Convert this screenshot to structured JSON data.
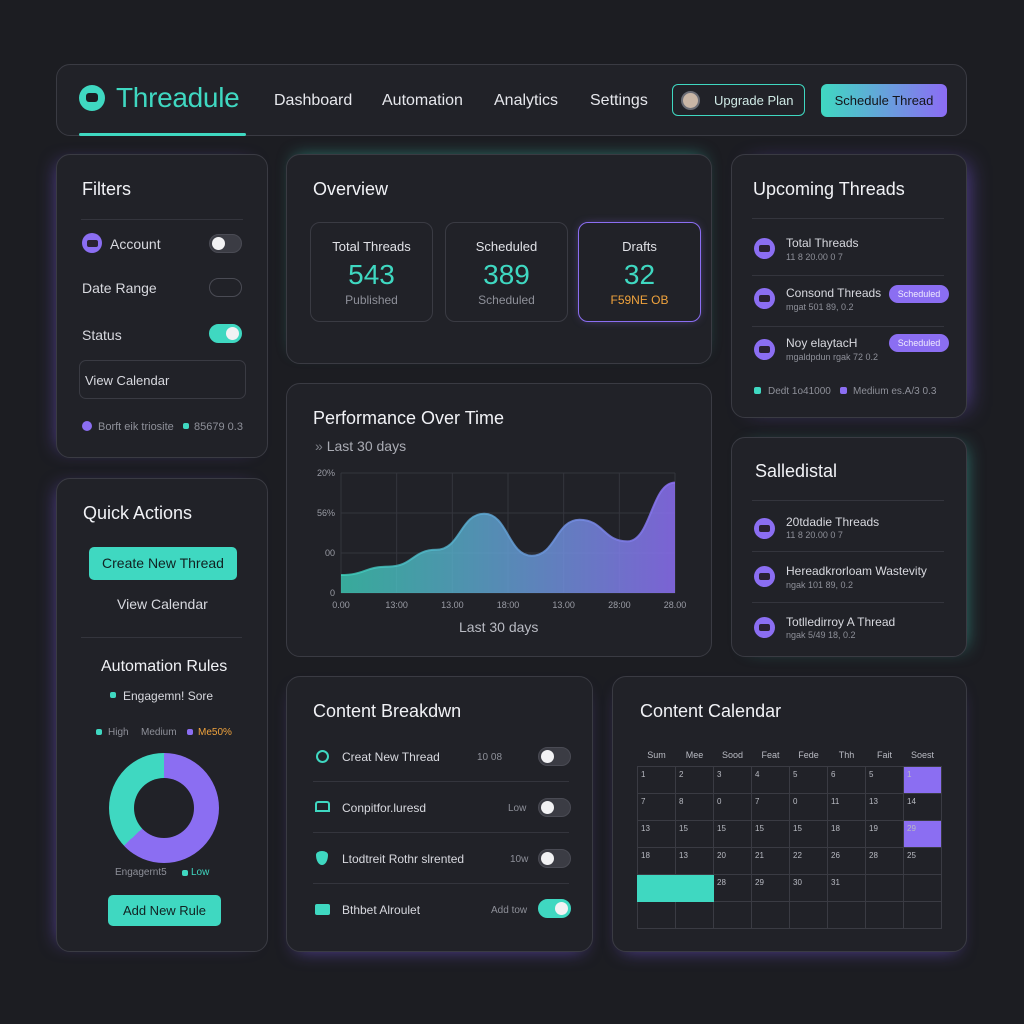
{
  "colors": {
    "accent": "#3fd8c1",
    "purple": "#8b6ef2",
    "background": "#1c1d22",
    "panel": "#212228"
  },
  "header": {
    "brand": "Threadule",
    "nav": [
      "Dashboard",
      "Automation",
      "Analytics",
      "Settings"
    ],
    "upgrade_label": "Upgrade Plan",
    "schedule_label": "Schedule Thread"
  },
  "filters": {
    "title": "Filters",
    "account": "Account",
    "date_range": "Date Range",
    "status": "Status",
    "view_calendar": "View Calendar",
    "footer_left": "Borft eik triosite",
    "footer_right": "85679 0.3",
    "toggles": {
      "account": false,
      "status": true
    }
  },
  "overview": {
    "title": "Overview",
    "stats": [
      {
        "label": "Total Threads",
        "value": "543",
        "sub": "Published"
      },
      {
        "label": "Scheduled",
        "value": "389",
        "sub": "Scheduled"
      },
      {
        "label": "Drafts",
        "value": "32",
        "sub": "F59NE OB"
      }
    ]
  },
  "upcoming": {
    "title": "Upcoming Threads",
    "items": [
      {
        "title": "Total Threads",
        "sub": "11 8 20.00 0 7",
        "badge": ""
      },
      {
        "title": "Consond Threads",
        "sub": "mgat 501 89, 0.2",
        "badge": "Scheduled"
      },
      {
        "title": "Noy elaytacH",
        "sub": "mgaldpdun rgak 72 0.2",
        "badge": "Scheduled"
      }
    ],
    "legend": [
      {
        "label": "Dedt 1o41000"
      },
      {
        "label": "Medium  es.A/3 0.3"
      }
    ]
  },
  "quick_actions": {
    "title": "Quick Actions",
    "create": "Create New Thread",
    "view_calendar": "View Calendar"
  },
  "automation": {
    "title": "Automation Rules",
    "legend_title": "Engagemn! Sore",
    "legend": [
      "High",
      "Medium",
      "Me50%"
    ],
    "footer_a": "Engagernt5",
    "footer_b": "Low",
    "add_rule": "Add New Rule"
  },
  "performance": {
    "title": "Performance Over Time",
    "subtitle": "Last 30 days",
    "x_caption": "Last 30 days"
  },
  "chart_data": {
    "type": "area",
    "title": "Performance Over Time",
    "subtitle": "Last 30 days",
    "xlabel": "Last 30 days",
    "ylabel": "",
    "yticks": [
      "20%",
      "56%",
      "00",
      "0"
    ],
    "x": [
      "0.00",
      "13:00",
      "13.00",
      "18:00",
      "13.00",
      "28:00",
      "28.00"
    ],
    "values": [
      0.15,
      0.22,
      0.36,
      0.66,
      0.31,
      0.61,
      0.43,
      0.92
    ],
    "colors": [
      "#3fd8c1",
      "#8b6ef2"
    ]
  },
  "scheduled": {
    "title": "Salledistal",
    "items": [
      {
        "title": "20tdadie Threads",
        "sub": "11 8 20.00 0 7"
      },
      {
        "title": "Hereadkrorloam Wastevity",
        "sub": "ngak 101 89, 0.2"
      },
      {
        "title": "Totlledirroy A Thread",
        "sub": "ngak 5/49 18, 0.2"
      }
    ]
  },
  "breakdown": {
    "title": "Content Breakdwn",
    "rows": [
      {
        "label": "Creat New Thread",
        "value": "10 08",
        "on": false
      },
      {
        "label": "Conpitfor.luresd",
        "value": "Low",
        "on": false
      },
      {
        "label": "Ltodtreit Rothr slrented",
        "value": "10w",
        "on": false
      },
      {
        "label": "Bthbet Alroulet",
        "value": "Add tow",
        "on": true
      }
    ]
  },
  "calendar": {
    "title": "Content Calendar",
    "days": [
      "Sum",
      "Mee",
      "Sood",
      "Feat",
      "Fede",
      "Thh",
      "Fait",
      "Soest"
    ],
    "weeks": [
      [
        "1",
        "2",
        "3",
        "4",
        "5",
        "6",
        "5",
        "1"
      ],
      [
        "7",
        "8",
        "0",
        "7",
        "0",
        "11",
        "13",
        "14"
      ],
      [
        "13",
        "15",
        "15",
        "15",
        "15",
        "18",
        "19",
        "29"
      ],
      [
        "18",
        "13",
        "20",
        "21",
        "22",
        "26",
        "28",
        "25"
      ],
      [
        "",
        "",
        "28",
        "29",
        "30",
        "31",
        "",
        ""
      ],
      [
        "",
        "",
        "",
        "",
        "",
        "",
        "",
        ""
      ]
    ]
  }
}
